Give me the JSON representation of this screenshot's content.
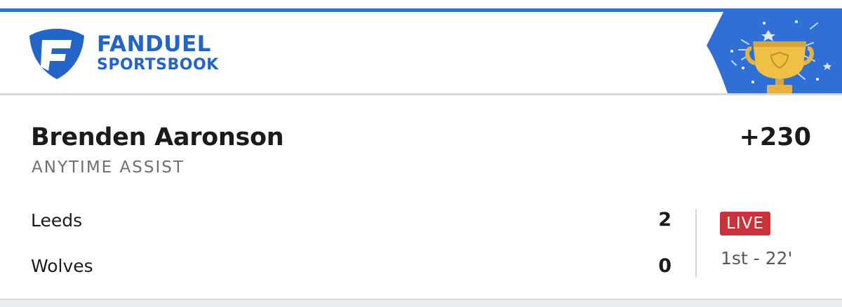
{
  "header": {
    "brand_line1": "FANDUEL",
    "brand_line2": "SPORTSBOOK",
    "logo_icon": "fanduel-shield-icon",
    "promo_icon": "trophy-icon",
    "brand_color": "#2364c8",
    "promo_bg_color": "#2f6fd6"
  },
  "bet": {
    "player": "Brenden Aaronson",
    "market": "ANYTIME ASSIST",
    "odds": "+230"
  },
  "match": {
    "teams": [
      {
        "name": "Leeds",
        "score": "2"
      },
      {
        "name": "Wolves",
        "score": "0"
      }
    ],
    "status_badge": "LIVE",
    "status_color": "#c9323a",
    "clock": "1st - 22'"
  }
}
